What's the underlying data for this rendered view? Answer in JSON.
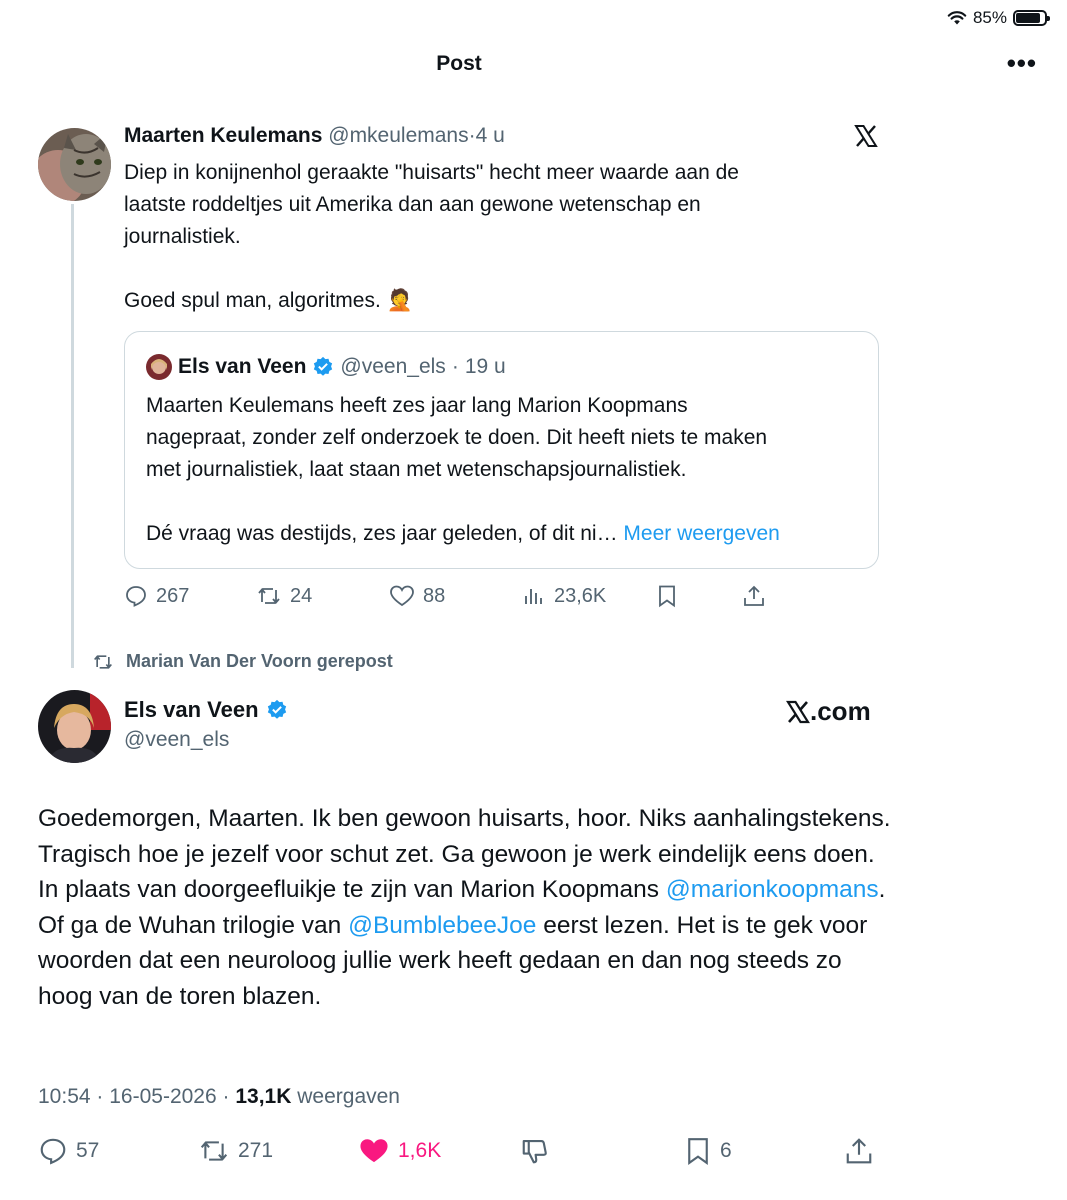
{
  "status_bar": {
    "battery": "85%",
    "battery_level": 0.85
  },
  "nav": {
    "title": "Post",
    "more_label": "•••"
  },
  "tweet1": {
    "name": "Maarten Keulemans",
    "handle": "@mkeulemans",
    "separator": "·",
    "time": "4 u",
    "lines": [
      "Diep in konijnenhol geraakte \"huisarts\" hecht meer waarde aan de",
      "laatste roddeltjes uit Amerika dan aan gewone wetenschap en",
      "journalistiek."
    ],
    "line2": "Goed spul man, algoritmes. 🤦",
    "quote": {
      "name": "Els van Veen",
      "handle": "@veen_els",
      "separator": "·",
      "time": "19 u",
      "lines": [
        "Maarten Keulemans heeft zes jaar lang Marion Koopmans",
        "nagepraat, zonder zelf onderzoek te doen. Dit heeft niets te maken",
        "met journalistiek, laat staan met wetenschapsjournalistiek."
      ],
      "last_line": "Dé vraag was destijds, zes jaar geleden, of dit ni",
      "ellipsis": "…",
      "more_link": "Meer weergeven"
    },
    "actions": {
      "replies": "267",
      "reposts": "24",
      "likes": "88",
      "views": "23,6K"
    }
  },
  "repost_banner": "Marian Van Der Voorn gerepost",
  "tweet2": {
    "name": "Els van Veen",
    "handle": "@veen_els",
    "source_logo": ".com",
    "text": {
      "part1": "Goedemorgen, Maarten. Ik ben gewoon huisarts, hoor. Niks aanhalingstekens. Tragisch hoe je jezelf voor schut zet. Ga gewoon je werk eindelijk eens doen. In plaats van doorgeefluikje te zijn van Marion Koopmans ",
      "mention1": "@marionkoopmans",
      "part2": ". Of ga de Wuhan trilogie van ",
      "mention2": "@BumblebeeJoe",
      "part3": " eerst lezen. Het is te gek voor woorden dat een neuroloog jullie werk heeft gedaan en dan nog steeds zo hoog van de toren blazen."
    },
    "meta": {
      "time": "10:54",
      "separator": "·",
      "date": "16-05-2026",
      "views": "13,1K",
      "views_label": "weergaven"
    },
    "actions": {
      "replies": "57",
      "reposts": "271",
      "likes": "1,6K",
      "bookmarks": "6"
    }
  },
  "colors": {
    "accent": "#1d9bf0",
    "like": "#f91880",
    "muted": "#536471",
    "text": "#0f1419",
    "border": "#cfd9de"
  }
}
